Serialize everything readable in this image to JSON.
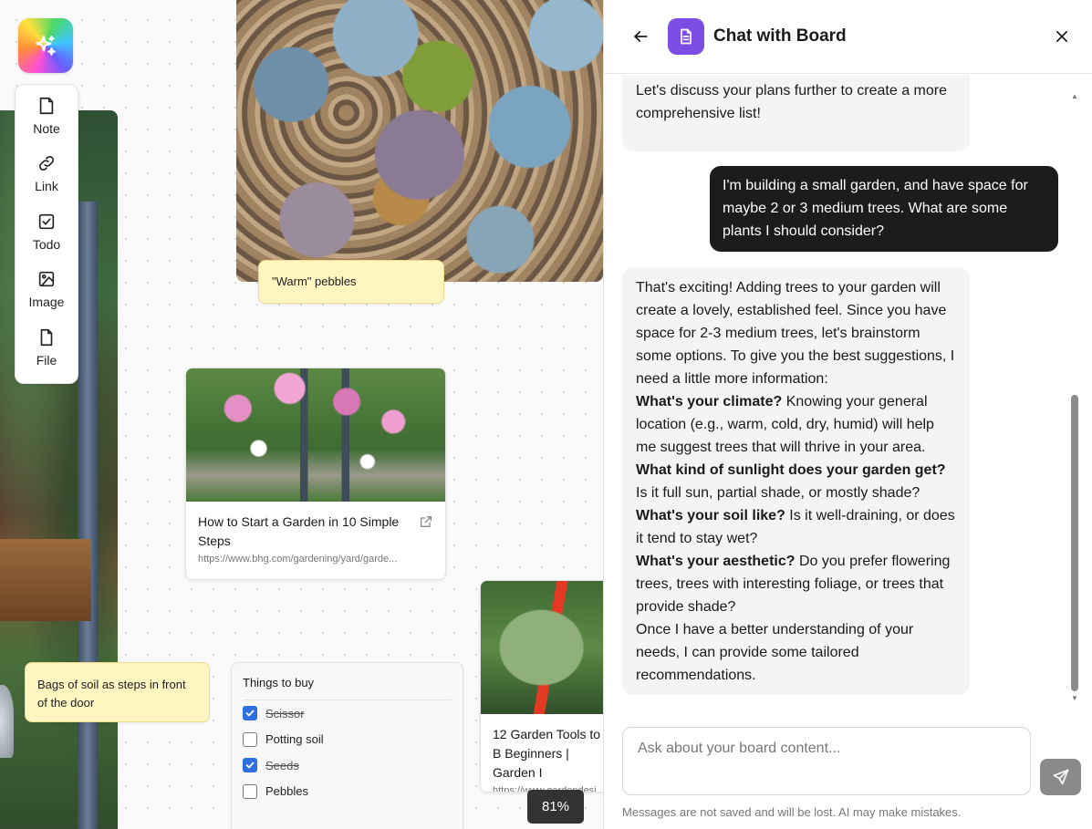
{
  "toolbar": {
    "items": [
      {
        "label": "Note",
        "icon": "note-icon"
      },
      {
        "label": "Link",
        "icon": "link-icon"
      },
      {
        "label": "Todo",
        "icon": "todo-icon"
      },
      {
        "label": "Image",
        "icon": "image-icon"
      },
      {
        "label": "File",
        "icon": "file-icon"
      }
    ]
  },
  "canvas": {
    "note_pebbles": "\"Warm\" pebbles",
    "note_soil": "Bags of soil as steps in front of the door",
    "link_cards": [
      {
        "title": "How to Start a Garden in 10 Simple Steps",
        "url": "https://www.bhg.com/gardening/yard/garde..."
      },
      {
        "title": "12 Garden Tools to B Beginners | Garden I",
        "url": "https://www.gardendesi"
      }
    ],
    "todo": {
      "title": "Things to buy",
      "items": [
        {
          "label": "Scissor",
          "checked": true
        },
        {
          "label": "Potting soil",
          "checked": false
        },
        {
          "label": "Seeds",
          "checked": true
        },
        {
          "label": "Pebbles",
          "checked": false
        }
      ]
    },
    "zoom": "81%"
  },
  "chat": {
    "title": "Chat with Board",
    "prev_message_tail": "Let's discuss your plans further to create a more comprehensive list!",
    "user_message": "I'm building a small garden, and have space for maybe 2 or 3 medium trees. What are some plants I should consider?",
    "ai_message": {
      "intro": "That's exciting! Adding trees to your garden will create a lovely, established feel. Since you have space for 2-3 medium trees, let's brainstorm some options. To give you the best suggestions, I need a little more information:",
      "q1_bold": "What's your climate?",
      "q1_text": " Knowing your general location (e.g., warm, cold, dry, humid) will help me suggest trees that will thrive in your area.",
      "q2_bold": "What kind of sunlight does your garden get?",
      "q2_text": " Is it full sun, partial shade, or mostly shade?",
      "q3_bold": "What's your soil like?",
      "q3_text": " Is it well-draining, or does it tend to stay wet?",
      "q4_bold": "What's your aesthetic?",
      "q4_text": " Do you prefer flowering trees, trees with interesting foliage, or trees that provide shade?",
      "outro": "Once I have a better understanding of your needs, I can provide some tailored recommendations."
    },
    "input_placeholder": "Ask about your board content...",
    "disclaimer": "Messages are not saved and will be lost. AI may make mistakes."
  },
  "colors": {
    "accent_purple": "#7c4ee6",
    "user_bubble": "#1c1c1c",
    "ai_bubble": "#f4f4f4",
    "note_yellow": "#fef5c1",
    "checkbox_blue": "#2f6fe0"
  }
}
